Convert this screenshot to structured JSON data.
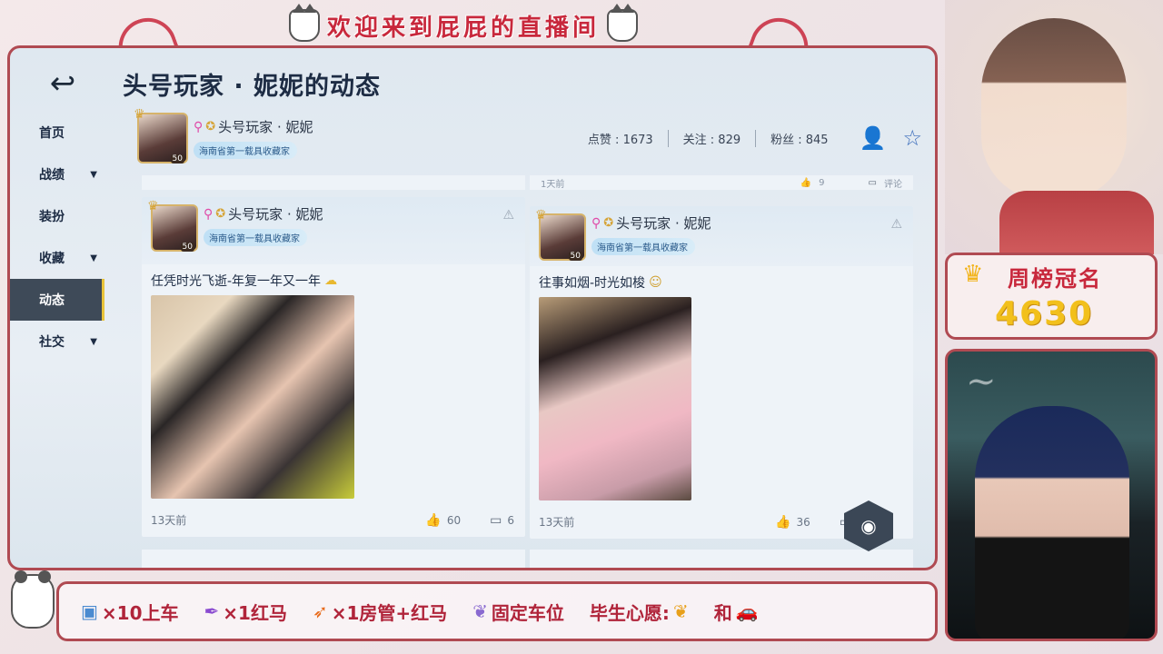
{
  "banner": {
    "title": "欢迎来到屁屁的直播间"
  },
  "app": {
    "page_title": "头号玩家 · 妮妮的动态"
  },
  "sidebar": {
    "items": [
      {
        "label": "首页",
        "has_caret": false
      },
      {
        "label": "战绩",
        "has_caret": true
      },
      {
        "label": "装扮",
        "has_caret": false
      },
      {
        "label": "收藏",
        "has_caret": true
      },
      {
        "label": "动态",
        "has_caret": false,
        "active": true
      },
      {
        "label": "社交",
        "has_caret": true
      }
    ]
  },
  "profile": {
    "name": "头号玩家 · 妮妮",
    "level": "50",
    "tag": "海南省第一载具收藏家",
    "stats": {
      "likes": "点赞 : 1673",
      "follows": "关注 : 829",
      "fans": "粉丝 : 845"
    }
  },
  "strip": {
    "time": "1天前",
    "likes": "9",
    "comment": "评论"
  },
  "posts": [
    {
      "name": "头号玩家 · 妮妮",
      "level": "50",
      "tag": "海南省第一载具收藏家",
      "text": "任凭时光飞逝-年复一年又一年",
      "time": "13天前",
      "likes": "60",
      "comments": "6"
    },
    {
      "name": "头号玩家 · 妮妮",
      "level": "50",
      "tag": "海南省第一载具收藏家",
      "text": "往事如烟-时光如梭",
      "time": "13天前",
      "likes": "36",
      "comments": ""
    }
  ],
  "weekly": {
    "title": "周榜冠名",
    "value": "4630"
  },
  "perks": [
    {
      "icon": "badge-icon",
      "text": "×10上车"
    },
    {
      "icon": "feather-icon",
      "text": "×1红马"
    },
    {
      "icon": "rocket-icon",
      "text": "×1房管+红马"
    },
    {
      "icon": "wings-icon",
      "text": "固定车位"
    },
    {
      "icon": "wings-icon",
      "text": "毕生心愿:"
    },
    {
      "icon": "car-icon",
      "text": "和"
    }
  ],
  "colors": {
    "accent": "#c8283c",
    "frame": "#b04a52",
    "gold": "#f2c01c",
    "nav_active": "#3e4a58"
  }
}
